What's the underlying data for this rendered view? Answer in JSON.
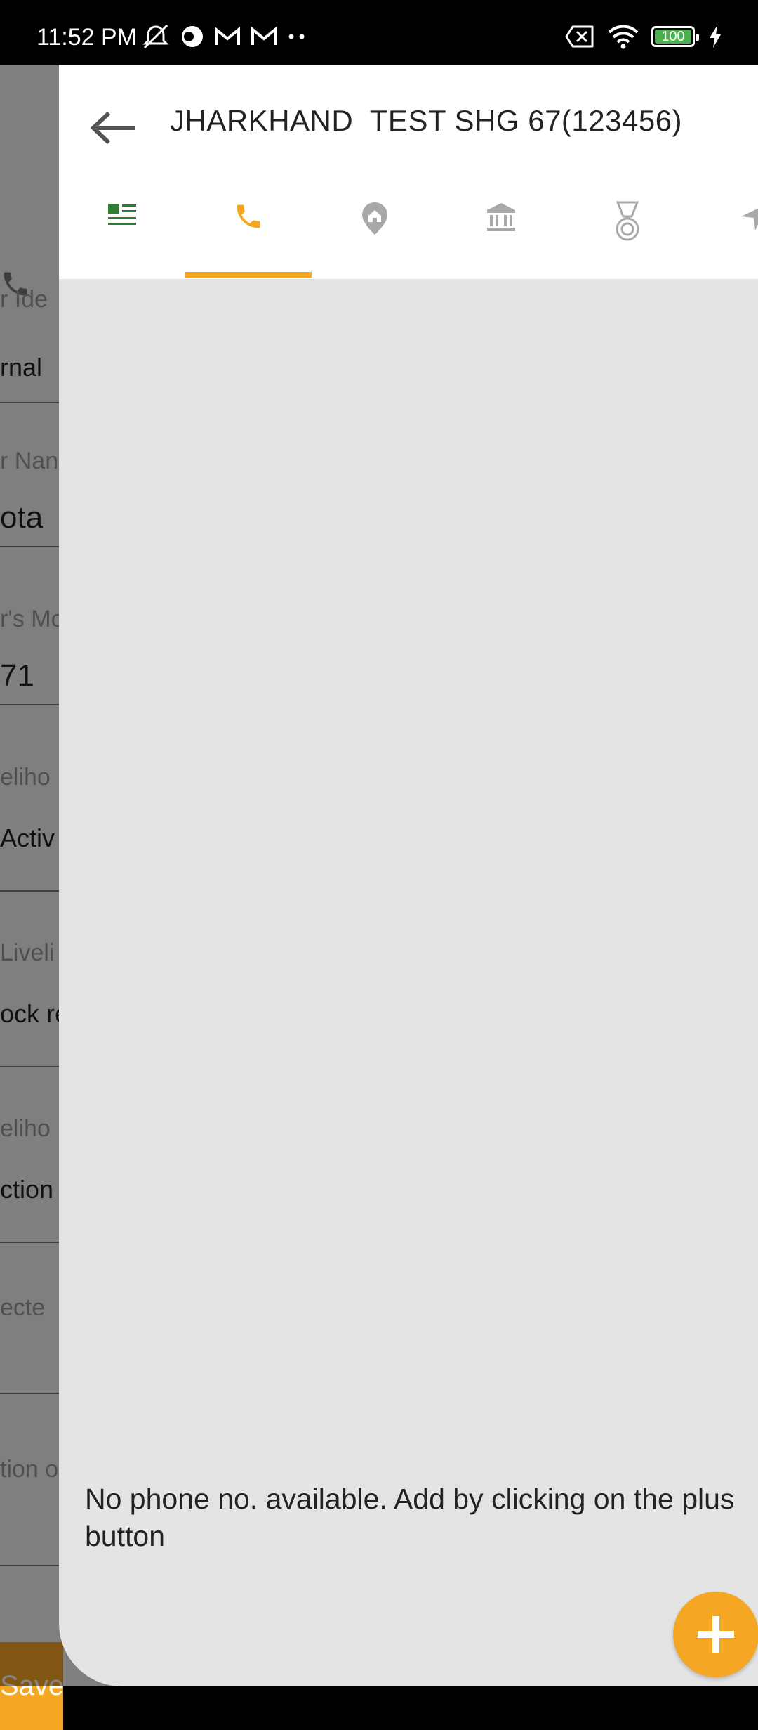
{
  "status_bar": {
    "time": "11:52 PM",
    "battery": "100",
    "icons": [
      "mute-icon",
      "app-icon",
      "gmail-icon",
      "gmail-icon",
      "more-dots-icon",
      "sim-x-icon",
      "wifi-icon",
      "battery-icon",
      "charging-icon"
    ]
  },
  "background_form": {
    "labels": [
      "r Ide",
      "r Nan",
      "r's Mo",
      "eliho",
      "Liveli",
      "eliho",
      "ecte",
      "tion o"
    ],
    "values": [
      "rnal",
      "ota",
      "71",
      " Activ",
      "ock re",
      "ction"
    ],
    "save_label": "Save"
  },
  "header": {
    "title": "JHARKHAND  TEST SHG 67(123456)",
    "back_icon": "arrow-left-icon"
  },
  "tabs": [
    {
      "name": "basic-details",
      "icon": "list-details-icon",
      "selected": false
    },
    {
      "name": "phone",
      "icon": "phone-icon",
      "selected": true
    },
    {
      "name": "address",
      "icon": "home-location-icon",
      "selected": false
    },
    {
      "name": "bank",
      "icon": "bank-icon",
      "selected": false
    },
    {
      "name": "award",
      "icon": "medal-icon",
      "selected": false
    },
    {
      "name": "more",
      "icon": "arrow-icon",
      "selected": false
    }
  ],
  "content": {
    "empty_message": "No phone no. available. Add by clicking on the plus button"
  },
  "colors": {
    "accent": "#f5a623",
    "green": "#2e7d32",
    "inactive_icon": "#a8a8a8",
    "panel_bg": "#e4e4e4"
  }
}
